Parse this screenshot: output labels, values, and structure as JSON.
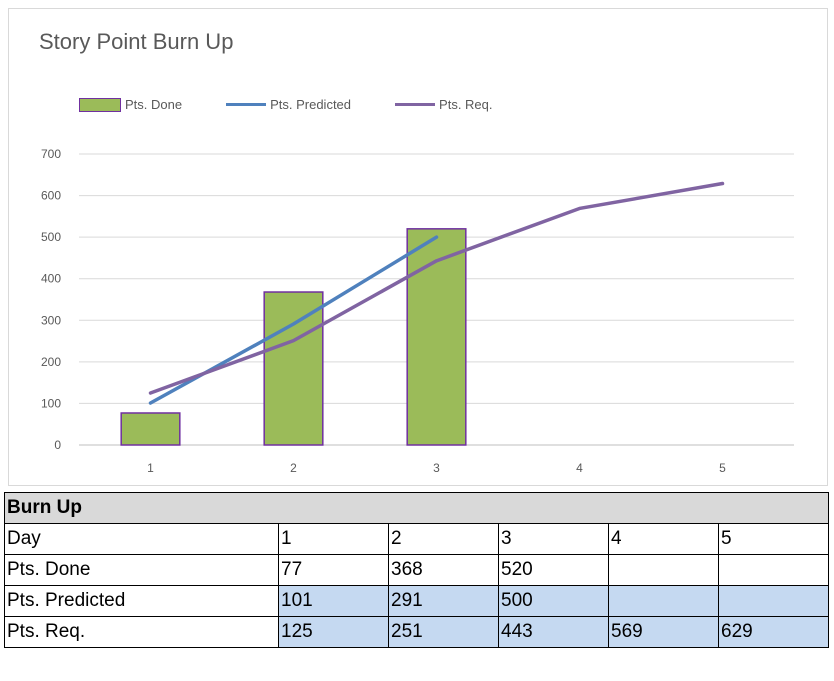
{
  "chart_data": {
    "type": "bar",
    "title": "Story Point Burn Up",
    "categories": [
      "1",
      "2",
      "3",
      "4",
      "5"
    ],
    "yticks": [
      "0",
      "100",
      "200",
      "300",
      "400",
      "500",
      "600",
      "700"
    ],
    "ylim": [
      0,
      700
    ],
    "grid": true,
    "legend_position": "top-left",
    "series": [
      {
        "name": "Pts. Done",
        "kind": "bar",
        "color": "#9bbb59",
        "border": "#7030a0",
        "values": [
          77,
          368,
          520,
          null,
          null
        ]
      },
      {
        "name": "Pts. Predicted",
        "kind": "line",
        "color": "#4f81bd",
        "values": [
          101,
          291,
          500,
          null,
          null
        ]
      },
      {
        "name": "Pts. Req.",
        "kind": "line",
        "color": "#8064a2",
        "values": [
          125,
          251,
          443,
          569,
          629
        ]
      }
    ]
  },
  "table": {
    "title": "Burn Up",
    "header": {
      "label": "Day",
      "values": [
        "1",
        "2",
        "3",
        "4",
        "5"
      ]
    },
    "rows": [
      {
        "label": "Pts. Done",
        "values": [
          "77",
          "368",
          "520",
          "",
          ""
        ],
        "highlight": false
      },
      {
        "label": "Pts. Predicted",
        "values": [
          "101",
          "291",
          "500",
          "",
          ""
        ],
        "highlight": true
      },
      {
        "label": "Pts. Req.",
        "values": [
          "125",
          "251",
          "443",
          "569",
          "629"
        ],
        "highlight": true
      }
    ]
  }
}
